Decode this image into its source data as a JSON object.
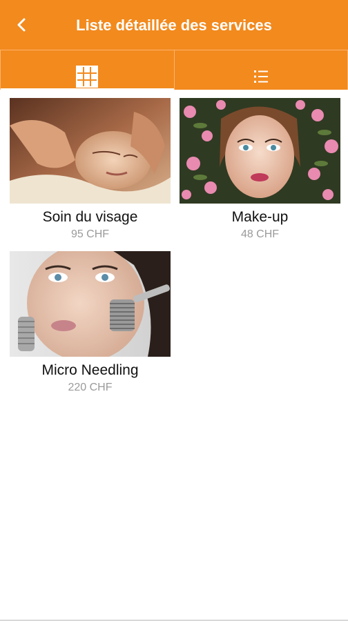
{
  "header": {
    "title": "Liste détaillée des services",
    "back_icon": "chevron-left-icon",
    "background": "#f28a1e"
  },
  "tabs": [
    {
      "icon": "grid-icon",
      "selected": true
    },
    {
      "icon": "list-icon",
      "selected": false
    }
  ],
  "services": [
    {
      "name": "Soin du visage",
      "price": "95 CHF",
      "image": "facial-massage-photo"
    },
    {
      "name": "Make-up",
      "price": "48 CHF",
      "image": "makeup-flowers-photo"
    },
    {
      "name": "Micro Needling",
      "price": "220 CHF",
      "image": "micro-needling-photo"
    }
  ]
}
